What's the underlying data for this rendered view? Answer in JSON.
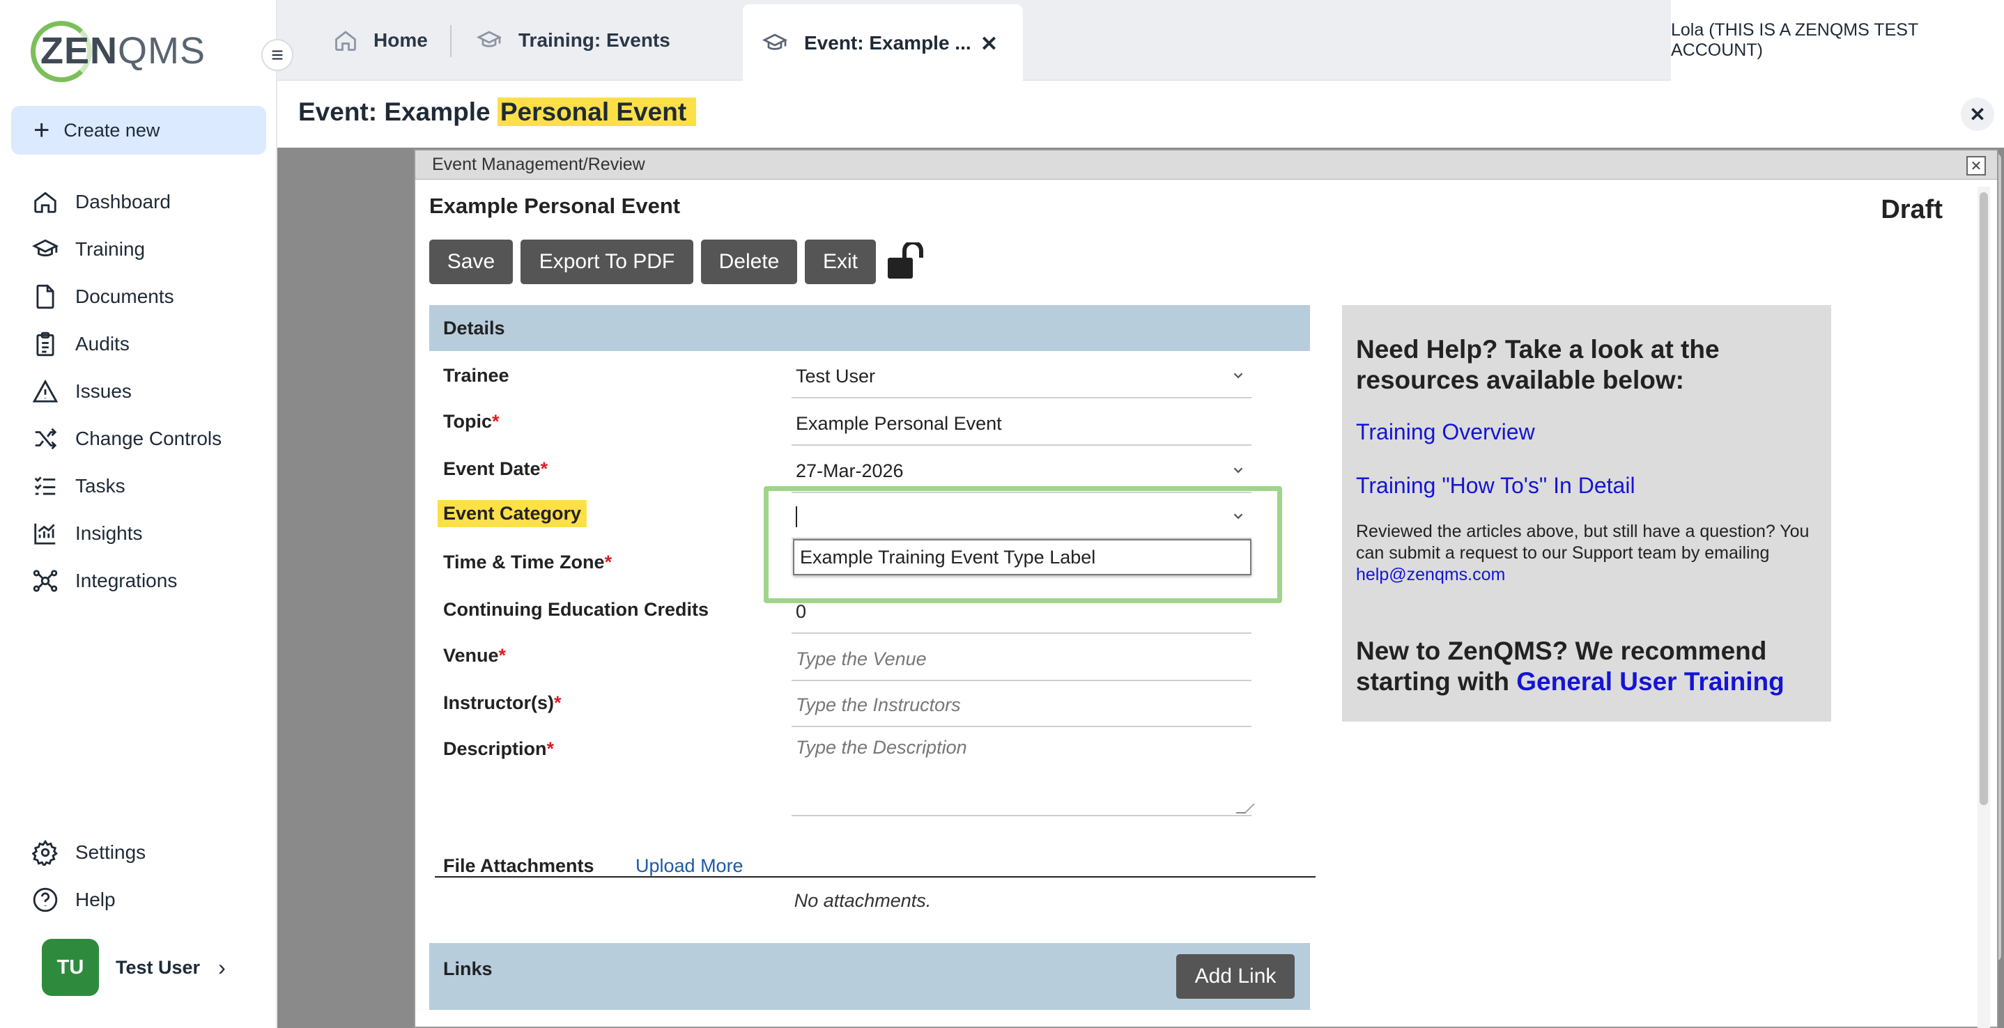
{
  "sidebar": {
    "logo": {
      "zen": "ZEN",
      "qms": "QMS"
    },
    "create_new": "Create new",
    "nav": [
      {
        "label": "Dashboard",
        "icon": "home-icon"
      },
      {
        "label": "Training",
        "icon": "graduation-cap-icon"
      },
      {
        "label": "Documents",
        "icon": "document-icon"
      },
      {
        "label": "Audits",
        "icon": "clipboard-icon"
      },
      {
        "label": "Issues",
        "icon": "warning-icon"
      },
      {
        "label": "Change Controls",
        "icon": "shuffle-icon"
      },
      {
        "label": "Tasks",
        "icon": "task-list-icon"
      },
      {
        "label": "Insights",
        "icon": "chart-icon"
      },
      {
        "label": "Integrations",
        "icon": "network-icon"
      }
    ],
    "bottom": [
      {
        "label": "Settings",
        "icon": "gear-icon"
      },
      {
        "label": "Help",
        "icon": "question-icon"
      }
    ],
    "user": {
      "initials": "TU",
      "name": "Test User"
    }
  },
  "tabs": {
    "home": "Home",
    "training_events": "Training: Events",
    "active": "Event: Example ...",
    "account": "Lola (THIS IS A ZENQMS TEST ACCOUNT)"
  },
  "page": {
    "title_prefix": "Event: Example ",
    "title_highlight": "Personal Event"
  },
  "modal": {
    "window_title": "Event Management/Review",
    "record_title": "Example Personal Event",
    "status": "Draft",
    "buttons": {
      "save": "Save",
      "export": "Export To PDF",
      "delete": "Delete",
      "exit": "Exit"
    },
    "details_header": "Details",
    "fields": {
      "trainee_label": "Trainee",
      "trainee_value": "Test User",
      "topic_label": "Topic",
      "topic_value": "Example Personal Event",
      "event_date_label": "Event Date",
      "event_date_value": "27-Mar-2026",
      "event_category_label": "Event Category",
      "event_category_value": "",
      "event_category_option": "Example Training Event Type Label",
      "time_zone_label": "Time & Time Zone",
      "ce_credits_label": "Continuing Education Credits",
      "ce_credits_value": "0",
      "venue_label": "Venue",
      "venue_placeholder": "Type the Venue",
      "instructors_label": "Instructor(s)",
      "instructors_placeholder": "Type the Instructors",
      "description_label": "Description",
      "description_placeholder": "Type the Description",
      "required_mark": "*"
    },
    "attachments": {
      "label": "File Attachments",
      "upload": "Upload More",
      "empty": "No attachments."
    },
    "links": {
      "header": "Links",
      "add": "Add Link"
    },
    "help": {
      "title": "Need Help? Take a look at the resources available below:",
      "link1": "Training Overview",
      "link2": "Training \"How To's\" In Detail",
      "body": "Reviewed the articles above, but still have a question? You can submit a request to our Support team by emailing",
      "email": "help@zenqms.com",
      "new_prefix": "New to ZenQMS? We recommend starting with",
      "new_link": "General User Training"
    }
  },
  "colors": {
    "accent": "#dbeafe",
    "highlight": "#fde047",
    "section_header": "#b7cddc",
    "button": "#555555",
    "link": "#1414d4",
    "focus_outline": "#9fd58a",
    "avatar": "#2e8b3e"
  }
}
